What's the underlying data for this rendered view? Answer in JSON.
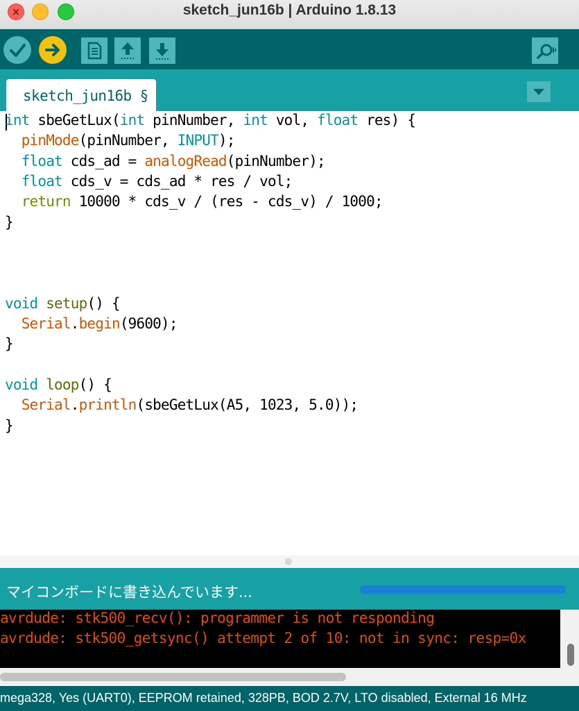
{
  "window": {
    "title": "sketch_jun16b | Arduino 1.8.13",
    "close_glyph": "×"
  },
  "toolbar": {
    "buttons": [
      "verify-icon",
      "upload-icon",
      "new-sketch-icon",
      "open-icon",
      "save-icon",
      "serial-monitor-icon"
    ]
  },
  "tabs": [
    {
      "label": "sketch_jun16b §",
      "active": true
    }
  ],
  "editor": {
    "code_lines": [
      [
        [
          "int",
          "kw"
        ],
        [
          " sbeGetLux(",
          ""
        ],
        [
          "int",
          "kw"
        ],
        [
          " pinNumber, ",
          ""
        ],
        [
          "int",
          "kw"
        ],
        [
          " vol, ",
          ""
        ],
        [
          "float",
          "kw"
        ],
        [
          " res) {",
          ""
        ]
      ],
      [
        [
          "  ",
          ""
        ],
        [
          "pinMode",
          "fn"
        ],
        [
          "(pinNumber, ",
          ""
        ],
        [
          "INPUT",
          "cst"
        ],
        [
          ");",
          ""
        ]
      ],
      [
        [
          "  ",
          ""
        ],
        [
          "float",
          "kw"
        ],
        [
          " cds_ad = ",
          ""
        ],
        [
          "analogRead",
          "fn"
        ],
        [
          "(pinNumber);",
          ""
        ]
      ],
      [
        [
          "  ",
          ""
        ],
        [
          "float",
          "kw"
        ],
        [
          " cds_v = cds_ad * res / vol;",
          ""
        ]
      ],
      [
        [
          "  ",
          ""
        ],
        [
          "return",
          "ret"
        ],
        [
          " 10000 * cds_v / (res - cds_v) / 1000;",
          ""
        ]
      ],
      [
        [
          "}",
          ""
        ]
      ],
      [],
      [],
      [],
      [
        [
          "void",
          "kw"
        ],
        [
          " ",
          ""
        ],
        [
          "setup",
          "ctl"
        ],
        [
          "() {",
          ""
        ]
      ],
      [
        [
          "  ",
          ""
        ],
        [
          "Serial",
          "fn"
        ],
        [
          ".",
          ""
        ],
        [
          "begin",
          "fn"
        ],
        [
          "(9600);",
          ""
        ]
      ],
      [
        [
          "}",
          ""
        ]
      ],
      [],
      [
        [
          "void",
          "kw"
        ],
        [
          " ",
          ""
        ],
        [
          "loop",
          "ctl"
        ],
        [
          "() {",
          ""
        ]
      ],
      [
        [
          "  ",
          ""
        ],
        [
          "Serial",
          "fn"
        ],
        [
          ".",
          ""
        ],
        [
          "println",
          "fn"
        ],
        [
          "(sbeGetLux(A5, 1023, 5.0));",
          ""
        ]
      ],
      [
        [
          "}",
          ""
        ]
      ]
    ]
  },
  "status": {
    "message": "マイコンボードに書き込んでいます...",
    "progress": 1.0
  },
  "console": {
    "lines": [
      "avrdude: stk500_recv(): programmer is not responding",
      "avrdude: stk500_getsync() attempt 2 of 10: not in sync: resp=0x"
    ]
  },
  "board": {
    "info": "mega328, Yes (UART0), EEPROM retained, 328PB, BOD 2.7V, LTO disabled, External 16 MHz"
  },
  "colors": {
    "toolbar": "#006468",
    "tab_strip": "#17a1a5",
    "keyword": "#00979c",
    "function": "#d35400",
    "console_text": "#e34c00"
  }
}
